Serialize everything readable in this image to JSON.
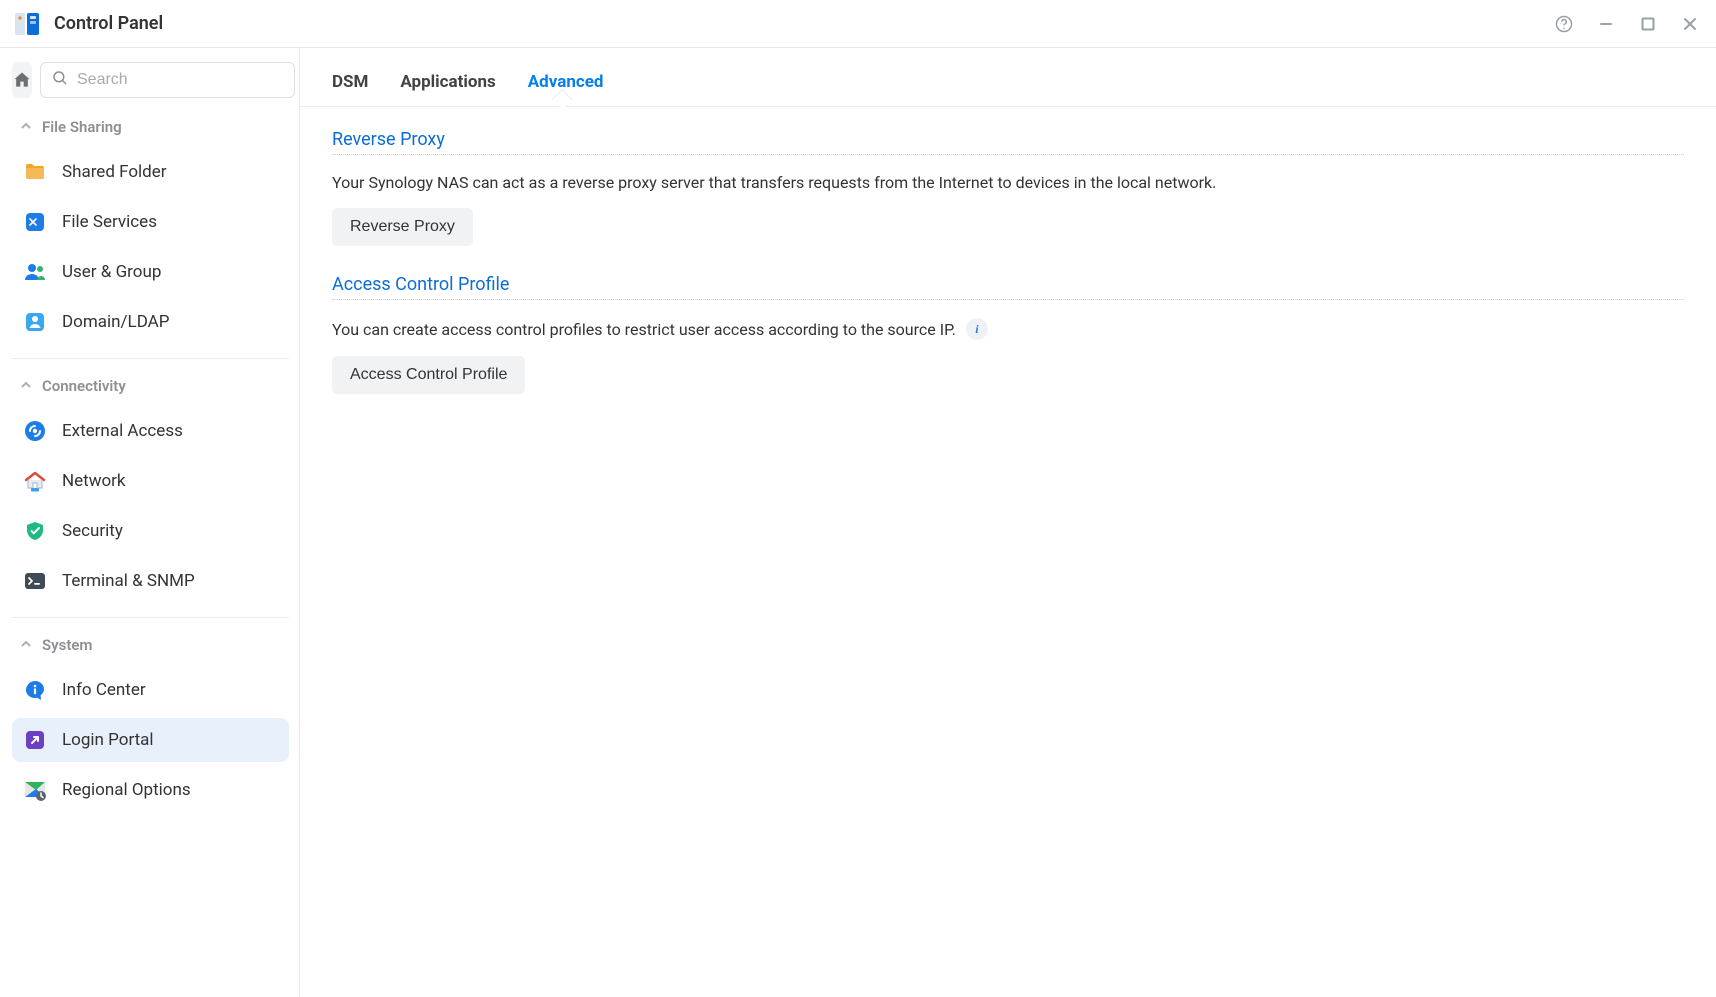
{
  "window": {
    "title": "Control Panel"
  },
  "search": {
    "placeholder": "Search"
  },
  "sidebar": {
    "sections": [
      {
        "name": "File Sharing",
        "items": [
          {
            "label": "Shared Folder",
            "icon": "folder-icon"
          },
          {
            "label": "File Services",
            "icon": "file-services-icon"
          },
          {
            "label": "User & Group",
            "icon": "users-icon"
          },
          {
            "label": "Domain/LDAP",
            "icon": "domain-icon"
          }
        ]
      },
      {
        "name": "Connectivity",
        "items": [
          {
            "label": "External Access",
            "icon": "external-access-icon"
          },
          {
            "label": "Network",
            "icon": "network-icon"
          },
          {
            "label": "Security",
            "icon": "security-icon"
          },
          {
            "label": "Terminal & SNMP",
            "icon": "terminal-icon"
          }
        ]
      },
      {
        "name": "System",
        "items": [
          {
            "label": "Info Center",
            "icon": "info-center-icon"
          },
          {
            "label": "Login Portal",
            "icon": "login-portal-icon",
            "active": true
          },
          {
            "label": "Regional Options",
            "icon": "regional-icon"
          }
        ]
      }
    ]
  },
  "tabs": [
    {
      "label": "DSM"
    },
    {
      "label": "Applications"
    },
    {
      "label": "Advanced",
      "active": true
    }
  ],
  "content": {
    "sections": [
      {
        "title": "Reverse Proxy",
        "desc": "Your Synology NAS can act as a reverse proxy server that transfers requests from the Internet to devices in the local network.",
        "button": "Reverse Proxy"
      },
      {
        "title": "Access Control Profile",
        "desc": "You can create access control profiles to restrict user access according to the source IP.",
        "has_info": true,
        "button": "Access Control Profile"
      }
    ]
  }
}
